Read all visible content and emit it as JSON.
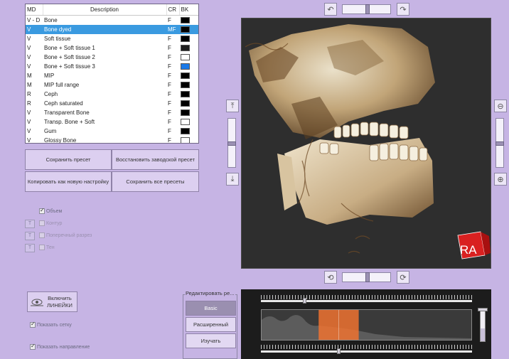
{
  "presets": {
    "columns": [
      "MD",
      "Description",
      "CR",
      "BK"
    ],
    "rows": [
      {
        "md": "V - D",
        "desc": "Bone",
        "cr": "F",
        "bk": "#000000",
        "selected": false
      },
      {
        "md": "V",
        "desc": "Bone dyed",
        "cr": "MF",
        "bk": "#000000",
        "selected": true
      },
      {
        "md": "V",
        "desc": "Soft tissue",
        "cr": "F",
        "bk": "#000000",
        "selected": false
      },
      {
        "md": "V",
        "desc": "Bone + Soft tissue 1",
        "cr": "F",
        "bk": "#1e1e1e",
        "selected": false
      },
      {
        "md": "V",
        "desc": "Bone + Soft tissue 2",
        "cr": "F",
        "bk": "#ffffff",
        "selected": false
      },
      {
        "md": "V",
        "desc": "Bone + Soft tissue 3",
        "cr": "F",
        "bk": "#1a7ae8",
        "selected": false
      },
      {
        "md": "M",
        "desc": "MIP",
        "cr": "F",
        "bk": "#000000",
        "selected": false
      },
      {
        "md": "M",
        "desc": "MIP full range",
        "cr": "F",
        "bk": "#000000",
        "selected": false
      },
      {
        "md": "R",
        "desc": "Ceph",
        "cr": "F",
        "bk": "#000000",
        "selected": false
      },
      {
        "md": "R",
        "desc": "Ceph saturated",
        "cr": "F",
        "bk": "#000000",
        "selected": false
      },
      {
        "md": "V",
        "desc": "Transparent Bone",
        "cr": "F",
        "bk": "#000000",
        "selected": false
      },
      {
        "md": "V",
        "desc": "Transp. Bone + Soft",
        "cr": "F",
        "bk": "#ffffff",
        "selected": false
      },
      {
        "md": "V",
        "desc": "Gum",
        "cr": "F",
        "bk": "#000000",
        "selected": false
      },
      {
        "md": "V",
        "desc": "Glossy Bone",
        "cr": "F",
        "bk": "#ffffff",
        "selected": false
      }
    ]
  },
  "buttons": {
    "save_preset": "Сохранить пресет",
    "restore_factory": "Восстановить заводской пресет",
    "copy_as_new": "Копировать как новую настройку",
    "save_all": "Сохранить все пресеты"
  },
  "options": {
    "volume": {
      "label": "Объем",
      "checked": true
    },
    "contour": {
      "label": "Контур",
      "checked": false
    },
    "cross_section": {
      "label": "Поперечный разрез",
      "checked": false
    },
    "shadow": {
      "label": "Тен",
      "checked": false
    },
    "t_label": "T"
  },
  "ruler_button": "Включить\nЛИНЕЙКИ",
  "show_grid": {
    "label": "Показать сетку",
    "checked": true
  },
  "show_direction": {
    "label": "Показать направление",
    "checked": true
  },
  "edit_group": {
    "title": "Редактировать ре...",
    "basic": "Basic",
    "advanced": "Расширенный",
    "study": "Изучать",
    "active": "basic"
  },
  "orientation_cube": "RA",
  "sliders": {
    "top_rotation": 0.5,
    "bottom_rotation": 0.5,
    "left_tilt": 0.5,
    "right_zoom": 0.5
  },
  "histogram": {
    "top_ruler_value": 0.2,
    "bottom_ruler_value": 0.36,
    "window_start": 0.27,
    "window_end": 0.46,
    "opacity_level": 0.42
  },
  "colors": {
    "background": "#c6b4e4",
    "selected_row": "#3a9ae0",
    "histogram_window": "#ee7230"
  }
}
